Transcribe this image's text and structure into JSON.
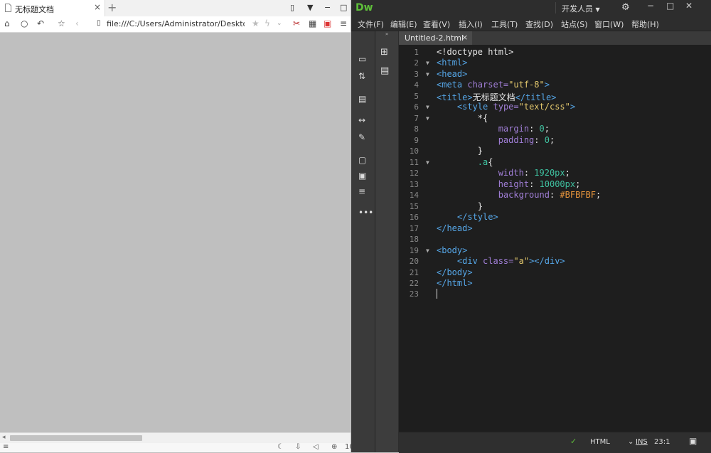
{
  "browser": {
    "tab_title": "无标题文档",
    "tab_close": "×",
    "new_tab": "+",
    "address": "file:///C:/Users/Administrator/Desktop/",
    "window_controls": {
      "minimize": "−",
      "maximize": "□"
    },
    "zoom_text": "10",
    "colors": {
      "page_background": "#BFBFBF"
    }
  },
  "dw": {
    "logo": "Dw",
    "workspace": "开发人员",
    "menu": [
      "文件(F)",
      "编辑(E)",
      "查看(V)",
      "插入(I)",
      "工具(T)",
      "查找(D)",
      "站点(S)",
      "窗口(W)",
      "帮助(H)"
    ],
    "doc_tab": "Untitled-2.html",
    "doc_tab_close": "×",
    "code_lines": [
      {
        "n": "1",
        "fold": ""
      },
      {
        "n": "2",
        "fold": "▼"
      },
      {
        "n": "3",
        "fold": "▼"
      },
      {
        "n": "4",
        "fold": ""
      },
      {
        "n": "5",
        "fold": ""
      },
      {
        "n": "6",
        "fold": "▼"
      },
      {
        "n": "7",
        "fold": "▼"
      },
      {
        "n": "8",
        "fold": ""
      },
      {
        "n": "9",
        "fold": ""
      },
      {
        "n": "10",
        "fold": ""
      },
      {
        "n": "11",
        "fold": "▼"
      },
      {
        "n": "12",
        "fold": ""
      },
      {
        "n": "13",
        "fold": ""
      },
      {
        "n": "14",
        "fold": ""
      },
      {
        "n": "15",
        "fold": ""
      },
      {
        "n": "16",
        "fold": ""
      },
      {
        "n": "17",
        "fold": ""
      },
      {
        "n": "18",
        "fold": ""
      },
      {
        "n": "19",
        "fold": "▼"
      },
      {
        "n": "20",
        "fold": ""
      },
      {
        "n": "21",
        "fold": ""
      },
      {
        "n": "22",
        "fold": ""
      },
      {
        "n": "23",
        "fold": ""
      }
    ],
    "code": {
      "l1": "<!doctype html>",
      "l2": "<html>",
      "l3": "<head>",
      "l4_tag": "<meta",
      "l4_attr": " charset=",
      "l4_val": "\"utf-8\"",
      "l4_end": ">",
      "l5_open": "<title>",
      "l5_text": "无标题文档",
      "l5_close": "</title>",
      "l6_tag": "<style",
      "l6_attr": " type=",
      "l6_val": "\"text/css\"",
      "l6_end": ">",
      "l7": "*{",
      "l8_prop": "margin",
      "l8_colon": ": ",
      "l8_val": "0",
      "l8_semi": ";",
      "l9_prop": "padding",
      "l9_colon": ": ",
      "l9_val": "0",
      "l9_semi": ";",
      "l10": "}",
      "l11_sel": ".a",
      "l11_brace": "{",
      "l12_prop": "width",
      "l12_colon": ": ",
      "l12_val": "1920px",
      "l12_semi": ";",
      "l13_prop": "height",
      "l13_colon": ": ",
      "l13_val": "10000px",
      "l13_semi": ";",
      "l14_prop": "background",
      "l14_colon": ": ",
      "l14_val": "#BFBFBF",
      "l14_semi": ";",
      "l15": "}",
      "l16": "</style>",
      "l17": "</head>",
      "l19": "<body>",
      "l20_tag": "<div",
      "l20_attr": " class=",
      "l20_val": "\"a\"",
      "l20_end": "></div>",
      "l21": "</body>",
      "l22": "</html>"
    },
    "status": {
      "language": "HTML",
      "mode": "INS",
      "position": "23:1"
    },
    "colors": {
      "logo": "#5FBF3A",
      "tag": "#56A7E8",
      "attribute": "#A07ED6",
      "string": "#E2C76D",
      "number": "#3FC1A0",
      "hex": "#E8953C"
    }
  }
}
